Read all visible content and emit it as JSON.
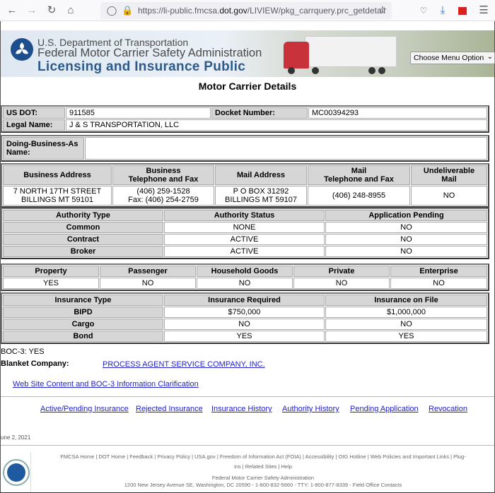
{
  "browser": {
    "url_prefix": "https://li-public.fmcsa.",
    "url_domain": "dot.gov",
    "url_path": "/LIVIEW/pkg_carrquery.prc_getdetail",
    "icons": [
      "back-icon",
      "forward-icon",
      "reload-icon",
      "home-icon",
      "shield-icon",
      "lock-icon",
      "star-icon",
      "pocket-icon",
      "download-icon",
      "extension-icon",
      "menu-icon"
    ]
  },
  "header": {
    "line1": "U.S. Department of Transportation",
    "line2": "Federal Motor Carrier Safety Administration",
    "line3": "Licensing and Insurance Public",
    "menu_select": "Choose Menu Option"
  },
  "page_title": "Motor Carrier Details",
  "ids": {
    "us_dot_label": "US DOT:",
    "us_dot": "911585",
    "docket_label": "Docket Number:",
    "docket": "MC00394293",
    "legal_name_label": "Legal Name:",
    "legal_name": "J & S TRANSPORTATION, LLC",
    "dba_label_1": "Doing-Business-As",
    "dba_label_2": "Name:",
    "dba": ""
  },
  "address": {
    "headers": [
      "Business Address",
      "Business",
      "Telephone and Fax",
      "Mail Address",
      "Mail",
      "Telephone and Fax",
      "Undeliverable",
      "Mail"
    ],
    "business_address": [
      "7 NORTH 17TH STREET",
      "BILLINGS MT 59101"
    ],
    "business_phone": [
      "(406) 259-1528",
      "Fax: (406) 254-2759"
    ],
    "mail_address": [
      "P O BOX 31292",
      "BILLINGS MT 59107"
    ],
    "mail_phone": "(406) 248-8955",
    "undeliverable": "NO"
  },
  "authority": {
    "headers": [
      "Authority Type",
      "Authority Status",
      "Application Pending"
    ],
    "rows": [
      {
        "type": "Common",
        "status": "NONE",
        "pending": "NO"
      },
      {
        "type": "Contract",
        "status": "ACTIVE",
        "pending": "NO"
      },
      {
        "type": "Broker",
        "status": "ACTIVE",
        "pending": "NO"
      }
    ]
  },
  "cargo": {
    "headers": [
      "Property",
      "Passenger",
      "Household Goods",
      "Private",
      "Enterprise"
    ],
    "values": [
      "YES",
      "NO",
      "NO",
      "NO",
      "NO"
    ]
  },
  "insurance": {
    "headers": [
      "Insurance Type",
      "Insurance Required",
      "Insurance on File"
    ],
    "rows": [
      {
        "type": "BIPD",
        "required": "$750,000",
        "on_file": "$1,000,000"
      },
      {
        "type": "Cargo",
        "required": "NO",
        "on_file": "NO"
      },
      {
        "type": "Bond",
        "required": "YES",
        "on_file": "YES"
      }
    ]
  },
  "boc3": "BOC-3: YES",
  "blanket_label": "Blanket Company:",
  "blanket_company": "PROCESS AGENT SERVICE COMPANY, INC.",
  "clarification_link": "Web Site Content and BOC-3 Information Clarification",
  "bottom_links": [
    "Active/Pending Insurance",
    "Rejected Insurance",
    "Insurance History",
    "Authority History",
    "Pending Application",
    "Revocation"
  ],
  "date": "une 2, 2021",
  "footer": {
    "links_line1": "FMCSA Home | DOT Home | Feedback | Privacy Policy | USA.gov | Freedom of Information Act (FOIA) | Accessibility | OIG Hotline | Web Policies and Important Links | Plug-",
    "links_line2": "ins | Related Sites | Help",
    "agency": "Federal Motor Carrier Safety Administration",
    "address": "1200 New Jersey Avenue SE, Washington, DC 20590 - 1-800-832-5660 - TTY: 1-800-877-8339 - Field Office Contacts"
  }
}
